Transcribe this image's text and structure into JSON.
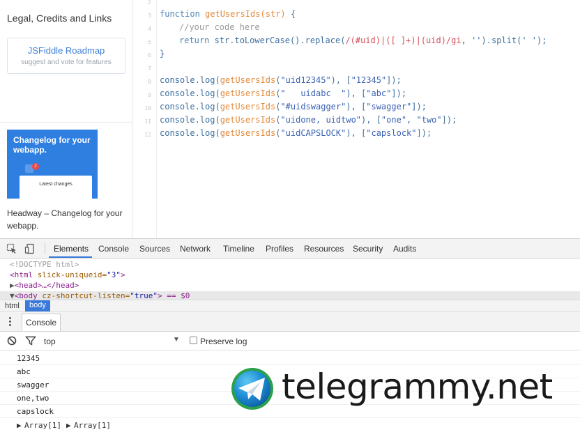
{
  "sidebar": {
    "heading": "Legal, Credits and Links",
    "roadmap": {
      "title": "JSFiddle Roadmap",
      "subtitle": "suggest and vote for features"
    },
    "ad": {
      "title": "Changelog for your webapp.",
      "card_text": "Latest changes",
      "badge": "2",
      "caption": "Headway – Changelog for your webapp."
    }
  },
  "editor": {
    "lines": [
      {
        "n": "2"
      },
      {
        "n": "3"
      },
      {
        "n": "4"
      },
      {
        "n": "5"
      },
      {
        "n": "6"
      },
      {
        "n": "7"
      },
      {
        "n": "8"
      },
      {
        "n": "9"
      },
      {
        "n": "10"
      },
      {
        "n": "11"
      },
      {
        "n": "12"
      }
    ],
    "code": {
      "l3_kw": "function",
      "l3_fn": "getUsersIds",
      "l3_args": "(str)",
      "l3_brace": " {",
      "l4": "//your code here",
      "l5_kw": "return",
      "l5_a": " str.toLowerCase().replace(",
      "l5_rx": "/(#uid)|([ ]+)|(uid)/gi",
      "l5_b": ", ",
      "l5_s1": "''",
      "l5_c": ").split(",
      "l5_s2": "' '",
      "l5_d": ");",
      "l6": "}",
      "calls": [
        {
          "pre": "console.log(",
          "fn": "getUsersIds",
          "a": "(",
          "arg": "\"uid12345\"",
          "b": "), [",
          "exp": "\"12345\"",
          "c": "]);"
        },
        {
          "pre": "console.log(",
          "fn": "getUsersIds",
          "a": "(",
          "arg": "\"   uidabc  \"",
          "b": "), [",
          "exp": "\"abc\"",
          "c": "]);"
        },
        {
          "pre": "console.log(",
          "fn": "getUsersIds",
          "a": "(",
          "arg": "\"#uidswagger\"",
          "b": "), [",
          "exp": "\"swagger\"",
          "c": "]);"
        },
        {
          "pre": "console.log(",
          "fn": "getUsersIds",
          "a": "(",
          "arg": "\"uidone, uidtwo\"",
          "b": "), [",
          "exp": "\"one\", \"two\"",
          "c": "]);"
        },
        {
          "pre": "console.log(",
          "fn": "getUsersIds",
          "a": "(",
          "arg": "\"uidCAPSLOCK\"",
          "b": "), [",
          "exp": "\"capslock\"",
          "c": "]);"
        }
      ]
    }
  },
  "devtools": {
    "tabs": [
      "Elements",
      "Console",
      "Sources",
      "Network",
      "Timeline",
      "Profiles",
      "Resources",
      "Security",
      "Audits"
    ],
    "active_tab": "Elements",
    "elements": {
      "doctype": "<!DOCTYPE html>",
      "html_open": "<html",
      "html_attr": " slick-uniqueid=",
      "html_val": "\"3\"",
      "html_close": ">",
      "head": "<head>…</head>",
      "body_open": "<body",
      "body_attr": " cz-shortcut-listen=",
      "body_val": "\"true\"",
      "body_rest": "> == $0"
    },
    "breadcrumbs": [
      "html",
      "body"
    ],
    "drawer_tab": "Console",
    "console_toolbar": {
      "context": "top",
      "preserve_log": "Preserve log"
    },
    "logs": [
      "12345",
      "abc",
      "swagger",
      "one,two",
      "capslock"
    ],
    "arrays": [
      "Array[1]",
      "Array[1]"
    ]
  },
  "watermark": {
    "text": "telegrammy.net"
  },
  "colors": {
    "accent": "#3879d9",
    "keyword": "#4f82b8",
    "function": "#e38a3a",
    "regex": "#d24f5a",
    "string": "#3b62b3"
  }
}
